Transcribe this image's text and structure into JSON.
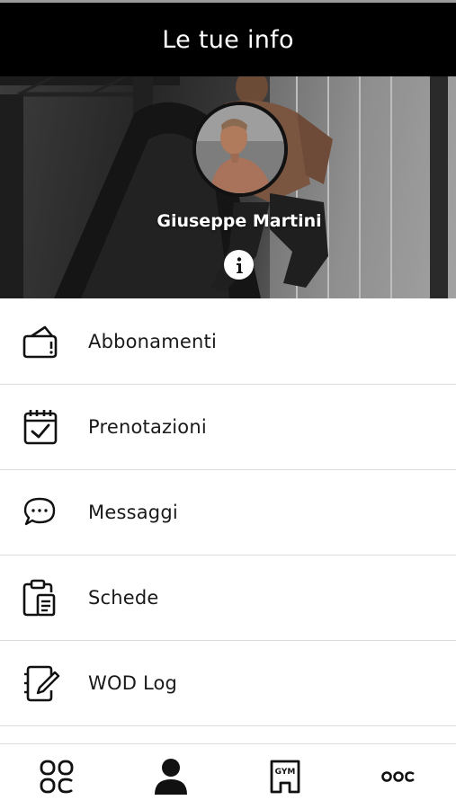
{
  "header": {
    "title": "Le tue info"
  },
  "profile": {
    "name": "Giuseppe Martini",
    "info_icon": "info-icon"
  },
  "menu": {
    "items": [
      {
        "label": "Abbonamenti",
        "icon": "subscription-card-icon"
      },
      {
        "label": "Prenotazioni",
        "icon": "calendar-check-icon"
      },
      {
        "label": "Messaggi",
        "icon": "chat-bubble-icon"
      },
      {
        "label": "Schede",
        "icon": "clipboard-icon"
      },
      {
        "label": "WOD Log",
        "icon": "notebook-pen-icon"
      }
    ]
  },
  "tabbar": {
    "tabs": [
      {
        "icon": "grid-icon",
        "active": false
      },
      {
        "icon": "user-icon",
        "active": true
      },
      {
        "icon": "gym-icon",
        "active": false,
        "icon_text": "GYM"
      },
      {
        "icon": "more-icon",
        "active": false
      }
    ]
  },
  "colors": {
    "header_bg": "#000000",
    "accent": "#111111",
    "divider": "#dcdcdc"
  }
}
